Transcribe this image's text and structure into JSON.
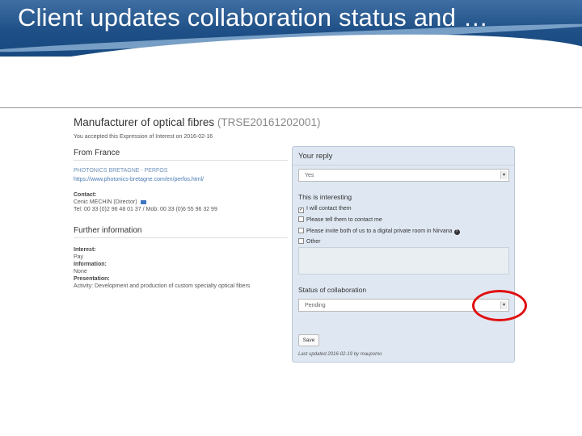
{
  "slide": {
    "title": "Client updates collaboration status and …"
  },
  "opportunity": {
    "title": "Manufacturer of optical fibres",
    "reference": "(TRSE20161202001)",
    "accepted_text": "You accepted this Expression of Interest on 2016-02-16",
    "from_heading": "From France",
    "company": "PHOTONICS BRETAGNE - PERFOS",
    "website": "https://www.photonics-bretagne.com/en/perfos.html/",
    "contact_label": "Contact:",
    "contact_name": "Cenic MECHIN (Director)",
    "contact_phone": "Tel: 00 33 (0)2 96 48 01 37 / Mob: 00 33 (0)6 55 96 32 99",
    "further_heading": "Further information",
    "interest_label": "Interest:",
    "interest_value": "Pay",
    "information_label": "Information:",
    "information_value": "None",
    "presentation_label": "Presentation:",
    "presentation_value": "Activity: Development and production of custom specialty optical fibers"
  },
  "reply": {
    "title": "Your reply",
    "selected": "Yes",
    "interesting_label": "This is interesting",
    "options": [
      {
        "label": "I will contact them",
        "checked": true,
        "help": false
      },
      {
        "label": "Please tell them to contact me",
        "checked": false,
        "help": false
      },
      {
        "label": "Please invite both of us to a digital private room in Nirvana",
        "checked": false,
        "help": true
      },
      {
        "label": "Other",
        "checked": false,
        "help": false
      }
    ],
    "status_label": "Status of collaboration",
    "status_value": "Pending",
    "save_label": "Save",
    "last_updated": "Last updated 2016-02-19 by maupomo"
  },
  "icons": {
    "dropdown": "▾",
    "check": "✓",
    "help": "?"
  },
  "colors": {
    "header_blue": "#1e4f86",
    "highlight_red": "#e01010",
    "panel_bg": "#dfe8f2"
  }
}
